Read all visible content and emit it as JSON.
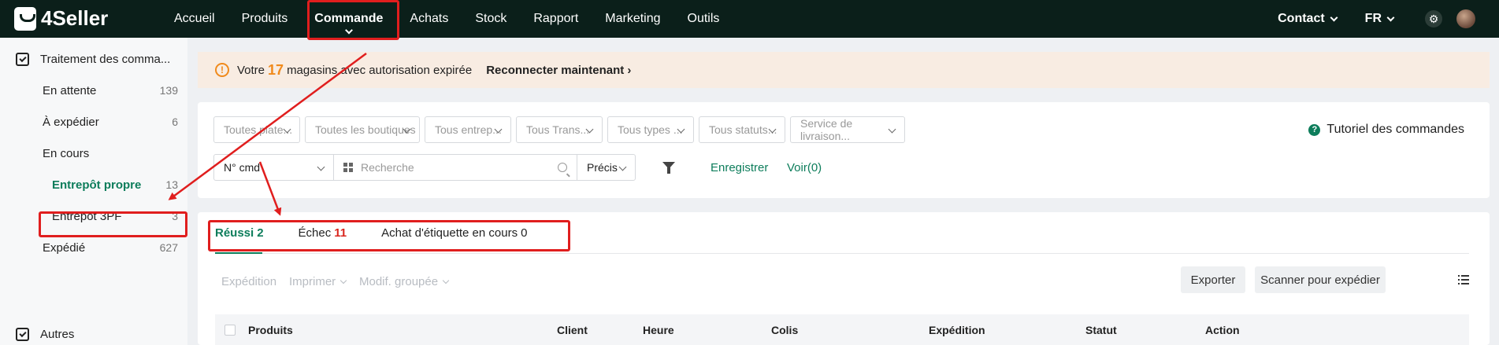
{
  "brand": {
    "name": "4Seller"
  },
  "nav": [
    {
      "label": "Accueil",
      "active": false
    },
    {
      "label": "Produits",
      "active": false
    },
    {
      "label": "Commande",
      "active": true
    },
    {
      "label": "Achats",
      "active": false
    },
    {
      "label": "Stock",
      "active": false
    },
    {
      "label": "Rapport",
      "active": false
    },
    {
      "label": "Marketing",
      "active": false
    },
    {
      "label": "Outils",
      "active": false
    }
  ],
  "header_right": {
    "contact": "Contact",
    "lang": "FR",
    "icons": [
      "gear-icon",
      "avatar"
    ]
  },
  "sidebar": {
    "group1": "Traitement des comma...",
    "items": [
      {
        "label": "En attente",
        "count": "139"
      },
      {
        "label": "À expédier",
        "count": "6"
      },
      {
        "label": "En cours",
        "count": ""
      },
      {
        "label": "Entrepôt propre",
        "count": "13",
        "active": true
      },
      {
        "label": "Entrepôt 3PF",
        "count": "3"
      },
      {
        "label": "Expédié",
        "count": "627"
      }
    ],
    "group2": "Autres"
  },
  "banner": {
    "prefix": "Votre",
    "count": "17",
    "suffix": "magasins avec autorisation expirée",
    "action": "Reconnecter maintenant"
  },
  "filters": {
    "selects": [
      "Toutes plate...",
      "Toutes les boutiques",
      "Tous entrep...",
      "Tous Trans...",
      "Tous types ...",
      "Tous statuts...",
      "Service de livraison..."
    ],
    "tutorial": "Tutoriel des commandes",
    "search_field": "N° cmd",
    "search_placeholder": "Recherche",
    "match": "Précis",
    "save": "Enregistrer",
    "view": "Voir(0)"
  },
  "tabs": [
    {
      "label": "Réussi",
      "count": "2",
      "active": true
    },
    {
      "label": "Échec",
      "count": "11",
      "active": false
    },
    {
      "label": "Achat d'étiquette en cours",
      "count": "0",
      "active": false
    }
  ],
  "actions": {
    "shipping": "Expédition",
    "print": "Imprimer",
    "bulk": "Modif. groupée",
    "export": "Exporter",
    "scan": "Scanner pour expédier"
  },
  "table": {
    "columns": [
      "Produits",
      "Client",
      "Heure",
      "Colis",
      "Expédition",
      "Statut",
      "Action"
    ]
  },
  "colors": {
    "accent": "#0d7d5b",
    "topbar": "#0b1f1a",
    "highlight": "#e01e1e",
    "warning": "#f08a1c",
    "error": "#d9251d"
  }
}
